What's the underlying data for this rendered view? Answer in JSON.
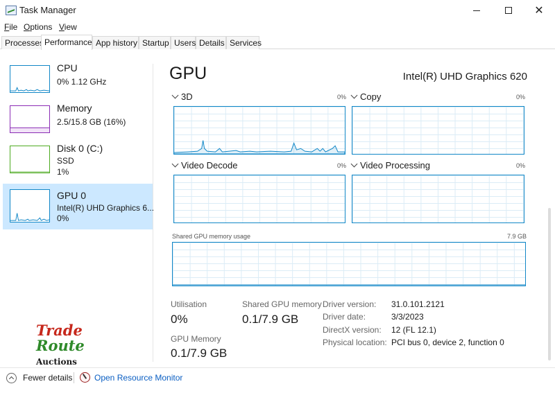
{
  "window": {
    "title": "Task Manager",
    "minimize": "",
    "maximize": "",
    "close": "✕"
  },
  "menu": [
    "File",
    "Options",
    "View"
  ],
  "tabs": [
    "Processes",
    "Performance",
    "App history",
    "Startup",
    "Users",
    "Details",
    "Services"
  ],
  "active_tab": "Performance",
  "resources": [
    {
      "title": "CPU",
      "sub1": "0%  1.12 GHz",
      "sub2": "",
      "color": "#1187c7"
    },
    {
      "title": "Memory",
      "sub1": "2.5/15.8 GB (16%)",
      "sub2": "",
      "color": "#8b2cb5"
    },
    {
      "title": "Disk 0 (C:)",
      "sub1": "SSD",
      "sub2": "1%",
      "color": "#4daa20"
    },
    {
      "title": "GPU 0",
      "sub1": "Intel(R) UHD Graphics 6...",
      "sub2": "0%",
      "color": "#1187c7"
    }
  ],
  "gpu": {
    "title": "GPU",
    "name": "Intel(R) UHD Graphics 620",
    "graphs": [
      {
        "label": "3D",
        "pct": "0%"
      },
      {
        "label": "Copy",
        "pct": "0%"
      },
      {
        "label": "Video Decode",
        "pct": "0%"
      },
      {
        "label": "Video Processing",
        "pct": "0%"
      }
    ],
    "shared_memory_label": "Shared GPU memory usage",
    "shared_memory_max": "7.9 GB"
  },
  "stats": {
    "utilisation_label": "Utilisation",
    "utilisation_value": "0%",
    "shared_label": "Shared GPU memory",
    "shared_value": "0.1/7.9 GB",
    "gpu_memory_label": "GPU Memory",
    "gpu_memory_value": "0.1/7.9 GB"
  },
  "info": [
    {
      "label": "Driver version:",
      "value": "31.0.101.2121"
    },
    {
      "label": "Driver date:",
      "value": "3/3/2023"
    },
    {
      "label": "DirectX version:",
      "value": "12 (FL 12.1)"
    },
    {
      "label": "Physical location:",
      "value": "PCI bus 0, device 2, function 0"
    }
  ],
  "logo": {
    "line1": "Trade",
    "line2": "Route",
    "line3": "Auctions"
  },
  "footer": {
    "fewer": "Fewer details",
    "monitor": "Open Resource Monitor"
  },
  "colors": {
    "accent": "#1187c7",
    "selected": "#cce8ff",
    "link": "#0a5ec2"
  }
}
